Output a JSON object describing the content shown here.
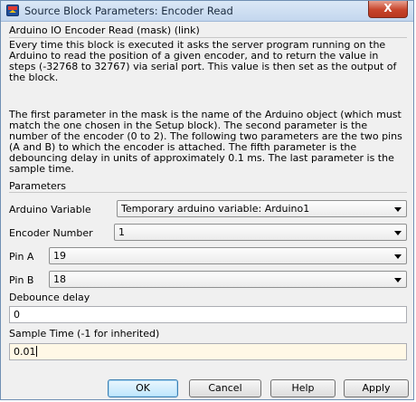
{
  "window": {
    "title": "Source Block Parameters: Encoder Read",
    "close_label": "X"
  },
  "description": {
    "group_title": "Arduino IO Encoder Read (mask) (link)",
    "paragraph1": "Every time this block is executed it asks the server program running on the Arduino to read the position of a given encoder, and to return the value in steps (-32768 to 32767) via serial port. This value is then set as the output of the block.",
    "paragraph2": "The first parameter in the mask is the name of the Arduino object (which must match the one chosen in the Setup block). The second parameter is the number of the encoder (0 to 2). The following two parameters are the two pins (A and B) to which the encoder is attached. The fifth parameter is the debouncing delay in units of approximately 0.1 ms. The last parameter is the sample time."
  },
  "parameters": {
    "group_title": "Parameters",
    "arduino_variable": {
      "label": "Arduino Variable",
      "value": "Temporary arduino variable: Arduino1"
    },
    "encoder_number": {
      "label": "Encoder Number",
      "value": "1"
    },
    "pin_a": {
      "label": "Pin A",
      "value": "19"
    },
    "pin_b": {
      "label": "Pin B",
      "value": "18"
    },
    "debounce_delay": {
      "label": "Debounce delay",
      "value": "0"
    },
    "sample_time": {
      "label": "Sample Time (-1 for inherited)",
      "value": "0.01"
    }
  },
  "buttons": {
    "ok": "OK",
    "cancel": "Cancel",
    "help": "Help",
    "apply": "Apply"
  }
}
